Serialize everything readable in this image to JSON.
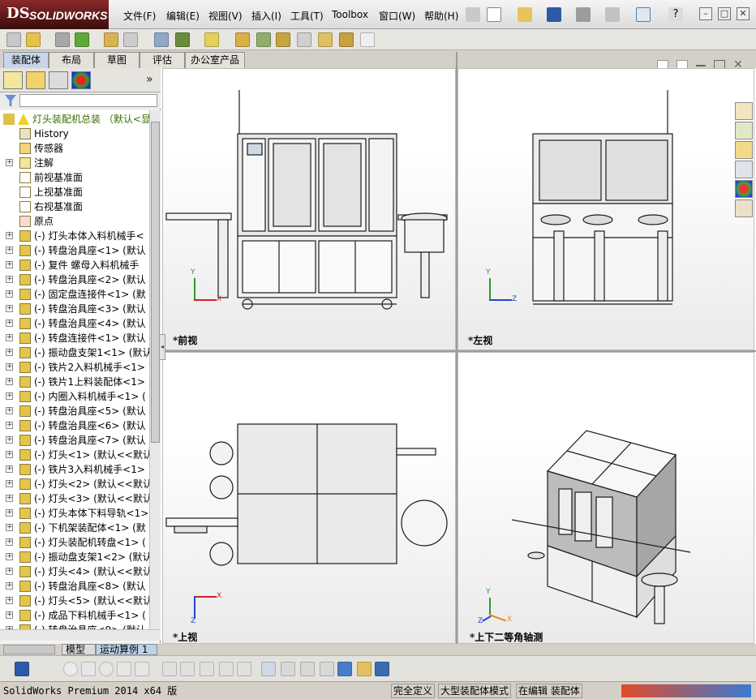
{
  "app": {
    "logo_ds": "DS",
    "logo_text": "SOLIDWORKS"
  },
  "menu": [
    {
      "label": "文件(F)"
    },
    {
      "label": "编辑(E)"
    },
    {
      "label": "视图(V)"
    },
    {
      "label": "插入(I)"
    },
    {
      "label": "工具(T)"
    },
    {
      "label": "Toolbox"
    },
    {
      "label": "窗口(W)"
    },
    {
      "label": "帮助(H)"
    }
  ],
  "window_controls": {
    "minimize": "–",
    "restore": "□",
    "close": "✕"
  },
  "command_tabs": [
    {
      "label": "装配体",
      "active": true
    },
    {
      "label": "布局",
      "active": false
    },
    {
      "label": "草图",
      "active": false
    },
    {
      "label": "评估",
      "active": false
    },
    {
      "label": "办公室产品",
      "active": false
    }
  ],
  "feature_manager": {
    "expand_glyph": "»",
    "root": {
      "label": "灯头装配机总装 （默认<显"
    },
    "items": [
      {
        "label": "History",
        "icon": "history-icon",
        "expandable": false
      },
      {
        "label": "传感器",
        "icon": "sensor-icon",
        "expandable": false
      },
      {
        "label": "注解",
        "icon": "annotation-icon",
        "expandable": true
      },
      {
        "label": "前视基准面",
        "icon": "plane-icon",
        "expandable": false
      },
      {
        "label": "上视基准面",
        "icon": "plane-icon",
        "expandable": false
      },
      {
        "label": "右视基准面",
        "icon": "plane-icon",
        "expandable": false
      },
      {
        "label": "原点",
        "icon": "origin-icon",
        "expandable": false
      },
      {
        "label": "(-) 灯头本体入料机械手<",
        "icon": "subassembly-icon",
        "expandable": true
      },
      {
        "label": "(-) 转盘治具座<1> (默认",
        "icon": "subassembly-icon",
        "expandable": true
      },
      {
        "label": "(-) 复件 螺母入料机械手",
        "icon": "subassembly-icon",
        "expandable": true
      },
      {
        "label": "(-) 转盘治具座<2> (默认",
        "icon": "subassembly-icon",
        "expandable": true
      },
      {
        "label": "(-) 固定盘连接件<1> (默",
        "icon": "subassembly-icon",
        "expandable": true
      },
      {
        "label": "(-) 转盘治具座<3> (默认",
        "icon": "subassembly-icon",
        "expandable": true
      },
      {
        "label": "(-) 转盘治具座<4> (默认",
        "icon": "subassembly-icon",
        "expandable": true
      },
      {
        "label": "(-) 转盘连接件<1> (默认",
        "icon": "subassembly-icon",
        "expandable": true
      },
      {
        "label": "(-) 振动盘支架1<1> (默认",
        "icon": "subassembly-icon",
        "expandable": true
      },
      {
        "label": "(-) 铁片2入料机械手<1>",
        "icon": "subassembly-icon",
        "expandable": true
      },
      {
        "label": "(-) 铁片1上料装配体<1>",
        "icon": "subassembly-icon",
        "expandable": true
      },
      {
        "label": "(-) 内圈入料机械手<1> (",
        "icon": "subassembly-icon",
        "expandable": true
      },
      {
        "label": "(-) 转盘治具座<5> (默认",
        "icon": "subassembly-icon",
        "expandable": true
      },
      {
        "label": "(-) 转盘治具座<6> (默认",
        "icon": "subassembly-icon",
        "expandable": true
      },
      {
        "label": "(-) 转盘治具座<7> (默认",
        "icon": "subassembly-icon",
        "expandable": true
      },
      {
        "label": "(-) 灯头<1> (默认<<默认",
        "icon": "subassembly-icon",
        "expandable": true
      },
      {
        "label": "(-) 铁片3入料机械手<1>",
        "icon": "subassembly-icon",
        "expandable": true
      },
      {
        "label": "(-) 灯头<2> (默认<<默认",
        "icon": "subassembly-icon",
        "expandable": true
      },
      {
        "label": "(-) 灯头<3> (默认<<默认",
        "icon": "subassembly-icon",
        "expandable": true
      },
      {
        "label": "(-) 灯头本体下料导轨<1>",
        "icon": "subassembly-icon",
        "expandable": true
      },
      {
        "label": "(-) 下机架装配体<1> (默",
        "icon": "subassembly-icon",
        "expandable": true
      },
      {
        "label": "(-) 灯头装配机转盘<1> (",
        "icon": "subassembly-icon",
        "expandable": true
      },
      {
        "label": "(-) 振动盘支架1<2> (默认",
        "icon": "subassembly-icon",
        "expandable": true
      },
      {
        "label": "(-) 灯头<4> (默认<<默认",
        "icon": "subassembly-icon",
        "expandable": true
      },
      {
        "label": "(-) 转盘治具座<8> (默认",
        "icon": "subassembly-icon",
        "expandable": true
      },
      {
        "label": "(-) 灯头<5> (默认<<默认",
        "icon": "subassembly-icon",
        "expandable": true
      },
      {
        "label": "(-) 成品下料机械手<1> (",
        "icon": "subassembly-icon",
        "expandable": true
      },
      {
        "label": "(-) 转盘治具座<9> (默认",
        "icon": "subassembly-icon",
        "expandable": true
      }
    ]
  },
  "bottom_tabs": [
    {
      "label": "模型",
      "active": false
    },
    {
      "label": "运动算例 1",
      "active": true
    }
  ],
  "viewports": {
    "front": "*前视",
    "left": "*左视",
    "top": "*上视",
    "iso": "*上下二等角轴测"
  },
  "axes": {
    "x": "X",
    "y": "Y",
    "z": "Z"
  },
  "status": {
    "version": "SolidWorks Premium 2014 x64 版",
    "definition": "完全定义",
    "mode": "大型装配体模式",
    "editing": "在编辑 装配体"
  },
  "colors": {
    "accent": "#1e5aa8",
    "highlight_tree": "#3a6e00",
    "machine_line": "#1a1a1a"
  }
}
